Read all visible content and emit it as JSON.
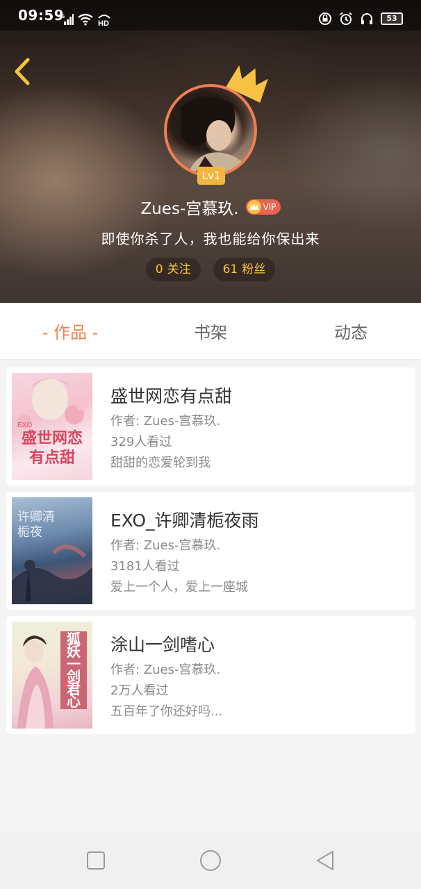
{
  "status_bar": {
    "time": "09:59",
    "network": "4G",
    "hd": "HD",
    "battery": "53",
    "icons": [
      "signal-icon",
      "wifi-icon",
      "hd-icon",
      "lock-rotation-icon",
      "alarm-icon",
      "headphones-icon",
      "battery-icon"
    ]
  },
  "profile": {
    "level": "Lv1",
    "username": "Zues-宫慕玖.",
    "vip_label": "VIP",
    "signature": "即使你杀了人，我也能给你保出来",
    "following": {
      "count": "0",
      "label": "关注"
    },
    "fans": {
      "count": "61",
      "label": "粉丝"
    },
    "colors": {
      "accent": "#ef8150",
      "stat_text": "#f5c33a",
      "crown": "#f7c244",
      "vip": "#e86552"
    }
  },
  "tabs": [
    {
      "label": "- 作品 -",
      "active": true
    },
    {
      "label": "书架",
      "active": false
    },
    {
      "label": "动态",
      "active": false
    }
  ],
  "books": [
    {
      "title": "盛世网恋有点甜",
      "author": "作者: Zues-宫慕玖.",
      "views": "329人看过",
      "desc": "甜甜的恋爱轮到我",
      "cover_text": "盛世网恋有点甜",
      "cover_tag": "EXO"
    },
    {
      "title": "EXO_许卿清栀夜雨",
      "author": "作者: Zues-宫慕玖.",
      "views": "3181人看过",
      "desc": "爱上一个人，爱上一座城",
      "cover_text": "许卿清栀夜"
    },
    {
      "title": "涂山一剑嗜心",
      "author": "作者: Zues-宫慕玖.",
      "views": "2万人看过",
      "desc": "五百年了你还好吗...",
      "cover_text": "狐妖一剑君心"
    }
  ],
  "nav": {
    "buttons": [
      "recent-apps-button",
      "home-button",
      "back-nav-button"
    ]
  }
}
